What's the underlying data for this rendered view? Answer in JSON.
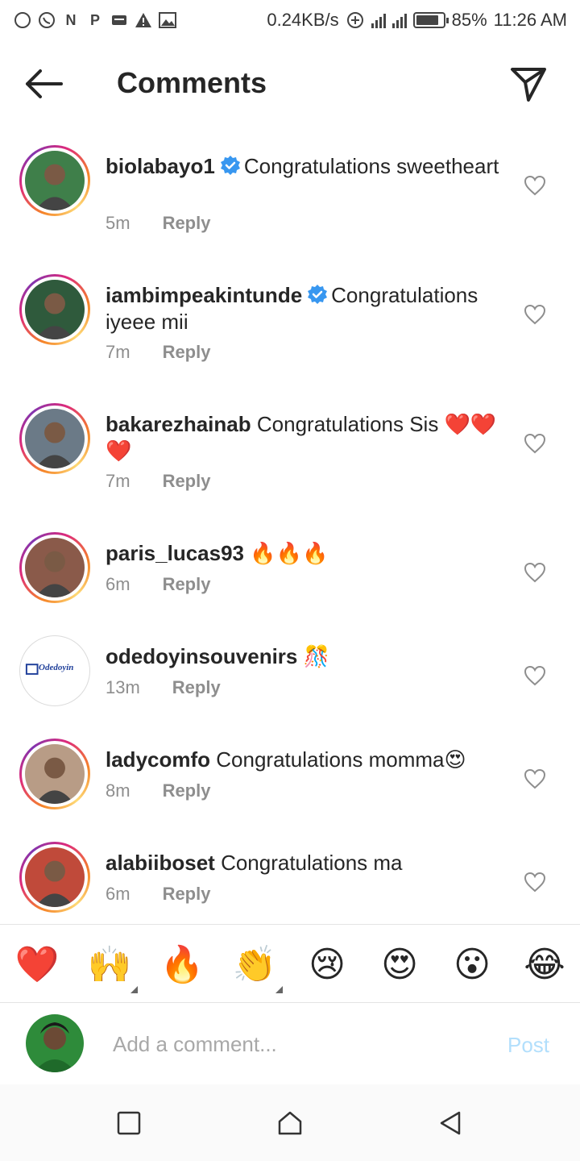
{
  "status_bar": {
    "icons": [
      "messenger-icon",
      "whatsapp-icon",
      "n-icon",
      "p-icon",
      "message-icon",
      "warning-icon",
      "image-icon"
    ],
    "network_speed": "0.24KB/s",
    "battery": "85%",
    "battery_level": 0.85,
    "time": "11:26 AM"
  },
  "header": {
    "title": "Comments"
  },
  "comments": [
    {
      "username": "biolabayo1",
      "verified": true,
      "text": "Congratulations sweetheart",
      "time": "5m",
      "reply_label": "Reply",
      "avatar_color": "#3f7f4a"
    },
    {
      "username": "iambimpeakintunde",
      "verified": true,
      "text": "Congratulations iyeee mii",
      "time": "7m",
      "reply_label": "Reply",
      "avatar_color": "#2f5a3c"
    },
    {
      "username": "bakarezhainab",
      "verified": false,
      "text": "Congratulations Sis ❤️❤️❤️",
      "time": "7m",
      "reply_label": "Reply",
      "avatar_color": "#6b7a87"
    },
    {
      "username": "paris_lucas93",
      "verified": false,
      "text": "🔥🔥🔥",
      "time": "6m",
      "reply_label": "Reply",
      "avatar_color": "#8a5a4a"
    },
    {
      "username": "odedoyinsouvenirs",
      "verified": false,
      "text": "🎊",
      "time": "13m",
      "reply_label": "Reply",
      "avatar_color": "#1f3f9a",
      "avatar_text": "Odedoyin"
    },
    {
      "username": "ladycomfo",
      "verified": false,
      "text": "Congratulations momma😍",
      "time": "8m",
      "reply_label": "Reply",
      "avatar_color": "#b89c86"
    },
    {
      "username": "alabiiboset",
      "verified": false,
      "text": "Congratulations ma",
      "time": "6m",
      "reply_label": "Reply",
      "avatar_color": "#c04a3a"
    }
  ],
  "reactions": [
    "❤️",
    "🙌",
    "🔥",
    "👏",
    "😢",
    "😍",
    "😮",
    "😂"
  ],
  "composer": {
    "placeholder": "Add a comment...",
    "post_label": "Post",
    "post_color": "#b2dffc"
  },
  "nav": {
    "icons": [
      "recents-icon",
      "home-icon",
      "back-icon"
    ]
  }
}
